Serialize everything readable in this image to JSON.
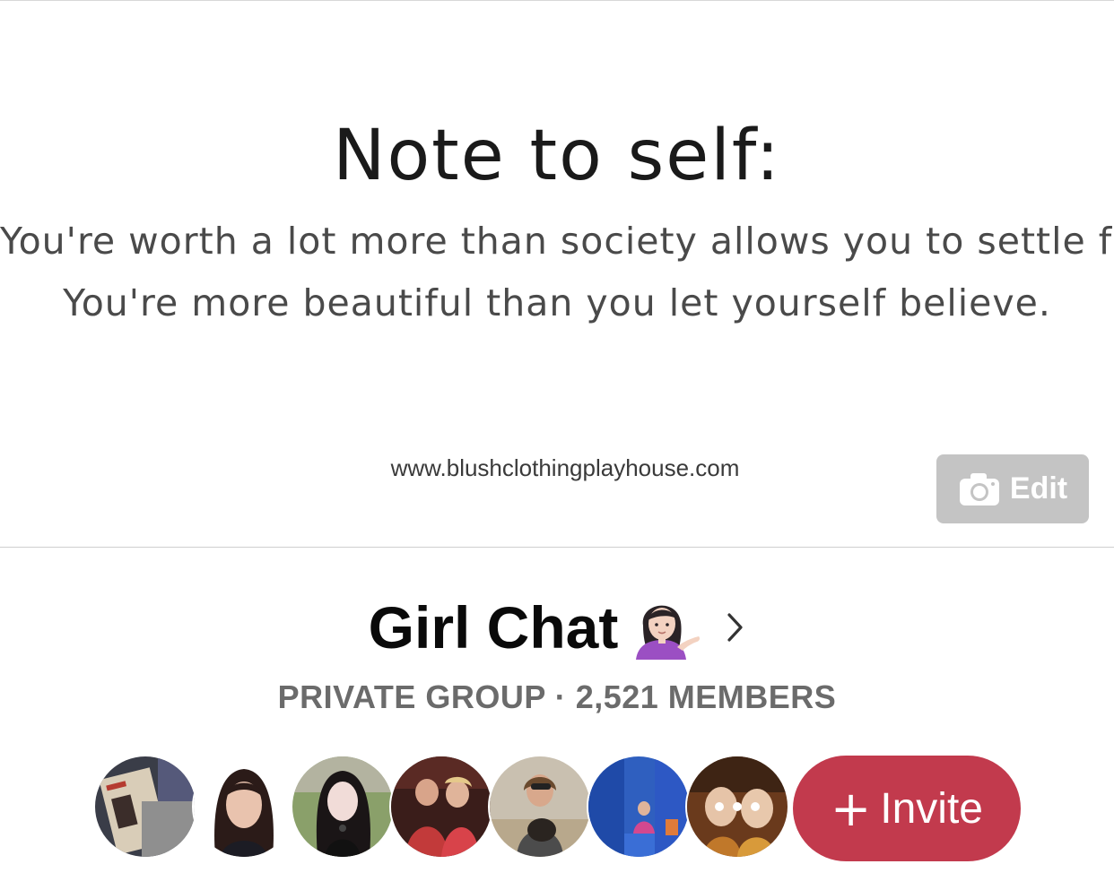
{
  "cover": {
    "quote_title": "Note to self:",
    "quote_line_1": "You're worth a lot more than society allows you to settle for.",
    "quote_line_2": "You're more beautiful than you let yourself believe.",
    "website": "www.blushclothingplayhouse.com",
    "edit_label": "Edit",
    "edit_icon": "camera-icon"
  },
  "group": {
    "name": "Girl Chat",
    "name_emoji": "woman-tipping-hand-emoji",
    "chevron_icon": "chevron-right-icon",
    "meta": "PRIVATE GROUP · 2,521 MEMBERS"
  },
  "members": {
    "avatars": [
      "avatar-1",
      "avatar-2",
      "avatar-3",
      "avatar-4",
      "avatar-5",
      "avatar-6",
      "avatar-7"
    ],
    "more_icon": "more-dots-icon",
    "invite_label": "Invite",
    "invite_icon": "plus-icon"
  },
  "colors": {
    "invite": "#c23a4d",
    "edit_bg": "#c4c4c4",
    "meta_text": "#6b6b6b"
  }
}
